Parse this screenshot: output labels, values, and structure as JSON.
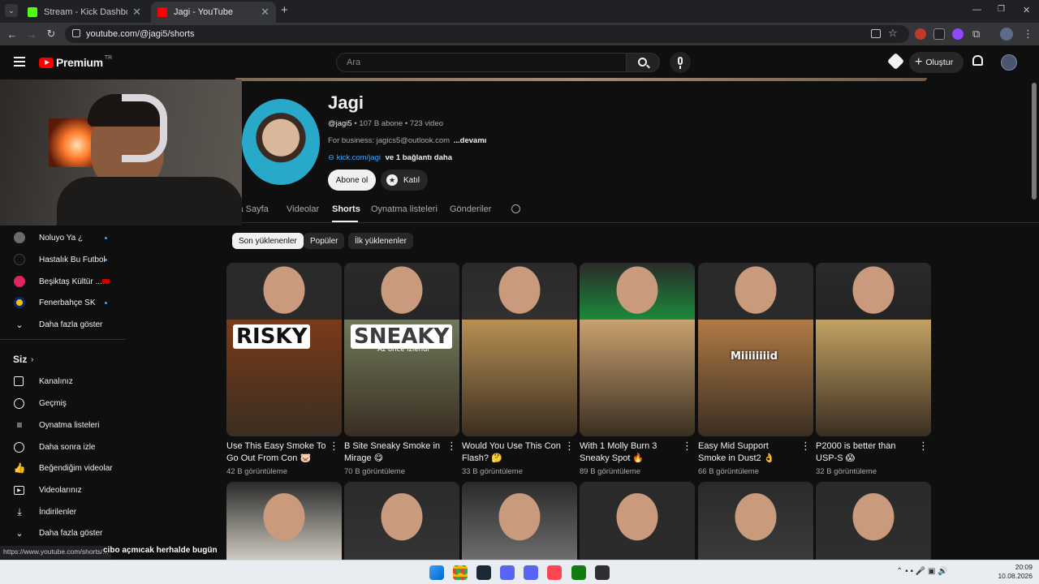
{
  "browser": {
    "tabs": [
      {
        "title": "Stream - Kick Dashboard",
        "active": false,
        "favicon_color": "#53fc18"
      },
      {
        "title": "Jagi - YouTube",
        "active": true,
        "favicon_color": "#ff0000"
      }
    ],
    "url": "youtube.com/@jagi5/shorts",
    "new_tab": "+"
  },
  "masthead": {
    "brand": "Premium",
    "brand_sup": "TR",
    "search_placeholder": "Ara",
    "create_label": "Oluştur"
  },
  "channel": {
    "name": "Jagi",
    "handle": "@jagi5",
    "subscribers": "107 B abone",
    "videos": "723 video",
    "description": "For business: jagics5@outlook.com",
    "more": "...devamı",
    "link": "kick.com/jagi",
    "link_more": "ve 1 bağlantı daha",
    "subscribe_label": "Abone ol",
    "join_label": "Katıl"
  },
  "tabs": [
    {
      "label": "Ana Sayfa",
      "active": false
    },
    {
      "label": "Videolar",
      "active": false
    },
    {
      "label": "Shorts",
      "active": true
    },
    {
      "label": "Oynatma listeleri",
      "active": false
    },
    {
      "label": "Gönderiler",
      "active": false
    }
  ],
  "filters": [
    {
      "label": "Son yüklenenler",
      "selected": true
    },
    {
      "label": "Popüler",
      "selected": false
    },
    {
      "label": "İlk yüklenenler",
      "selected": false
    }
  ],
  "sidebar": {
    "subscriptions": [
      {
        "label": "Noluyo Ya ¿",
        "icon": "channel-avatar-icon"
      },
      {
        "label": "Hastalık Bu Futbol",
        "icon": "channel-avatar-icon"
      },
      {
        "label": "Beşiktaş Kültür ...",
        "icon": "channel-avatar-icon"
      },
      {
        "label": "Fenerbahçe SK",
        "icon": "channel-avatar-icon"
      },
      {
        "label": "Daha fazla göster",
        "icon": "chevron-down-icon"
      }
    ],
    "you_header": "Siz",
    "you_items": [
      {
        "label": "Kanalınız",
        "icon": "channel-icon"
      },
      {
        "label": "Geçmiş",
        "icon": "history-icon"
      },
      {
        "label": "Oynatma listeleri",
        "icon": "playlist-icon"
      },
      {
        "label": "Daha sonra izle",
        "icon": "watch-later-icon"
      },
      {
        "label": "Beğendiğim videolar",
        "icon": "like-icon"
      },
      {
        "label": "Videolarınız",
        "icon": "your-videos-icon"
      },
      {
        "label": "İndirilenler",
        "icon": "download-icon"
      },
      {
        "label": "Daha fazla göster",
        "icon": "chevron-down-icon"
      }
    ]
  },
  "shorts": [
    {
      "title": "Use This Easy Smoke To Go Out From Con 🐷",
      "views": "42 B görüntüleme",
      "overlay": "RISKY",
      "scene": "#7a3a18",
      "shirt": "#2a2a2a"
    },
    {
      "title": "B Site Sneaky Smoke in Mirage 😋",
      "views": "70 B görüntüleme",
      "overlay": "SNEAKY",
      "badge": "Az önce izlendi",
      "scene": "#6f7a5a",
      "shirt": "#262626"
    },
    {
      "title": "Would You Use This Con Flash? 🤔",
      "views": "33 B görüntüleme",
      "overlay": "",
      "scene": "#b98f52",
      "shirt": "#303030"
    },
    {
      "title": "With 1 Molly Burn 3 Sneaky Spot 🔥",
      "views": "89 B görüntüleme",
      "overlay": "",
      "scene": "#c9a170",
      "shirt": "#1b8a3a"
    },
    {
      "title": "Easy Mid Support Smoke in Dust2 👌",
      "views": "66 B görüntüleme",
      "overlay": "Miiiiiiiid",
      "scene": "#b07a45",
      "shirt": "#2a2a2a"
    },
    {
      "title": "P2000 is better than USP-S 😱",
      "views": "32 B görüntüleme",
      "overlay": "",
      "scene": "#c2a263",
      "shirt": "#232323"
    }
  ],
  "second_row_shirts": [
    "#cfcac0",
    "#343434",
    "#6d6d6d",
    "#2b2b2b",
    "#3a3a3a",
    "#2e2e2e"
  ],
  "status": {
    "url": "https://www.youtube.com/shorts/...",
    "caption": "cibo açmıcak herhalde bugün"
  },
  "taskbar": {
    "time": "20:09",
    "date": "10.08.2026"
  },
  "colors": {
    "accent_red": "#ff0000",
    "bg": "#0f0f0f"
  }
}
